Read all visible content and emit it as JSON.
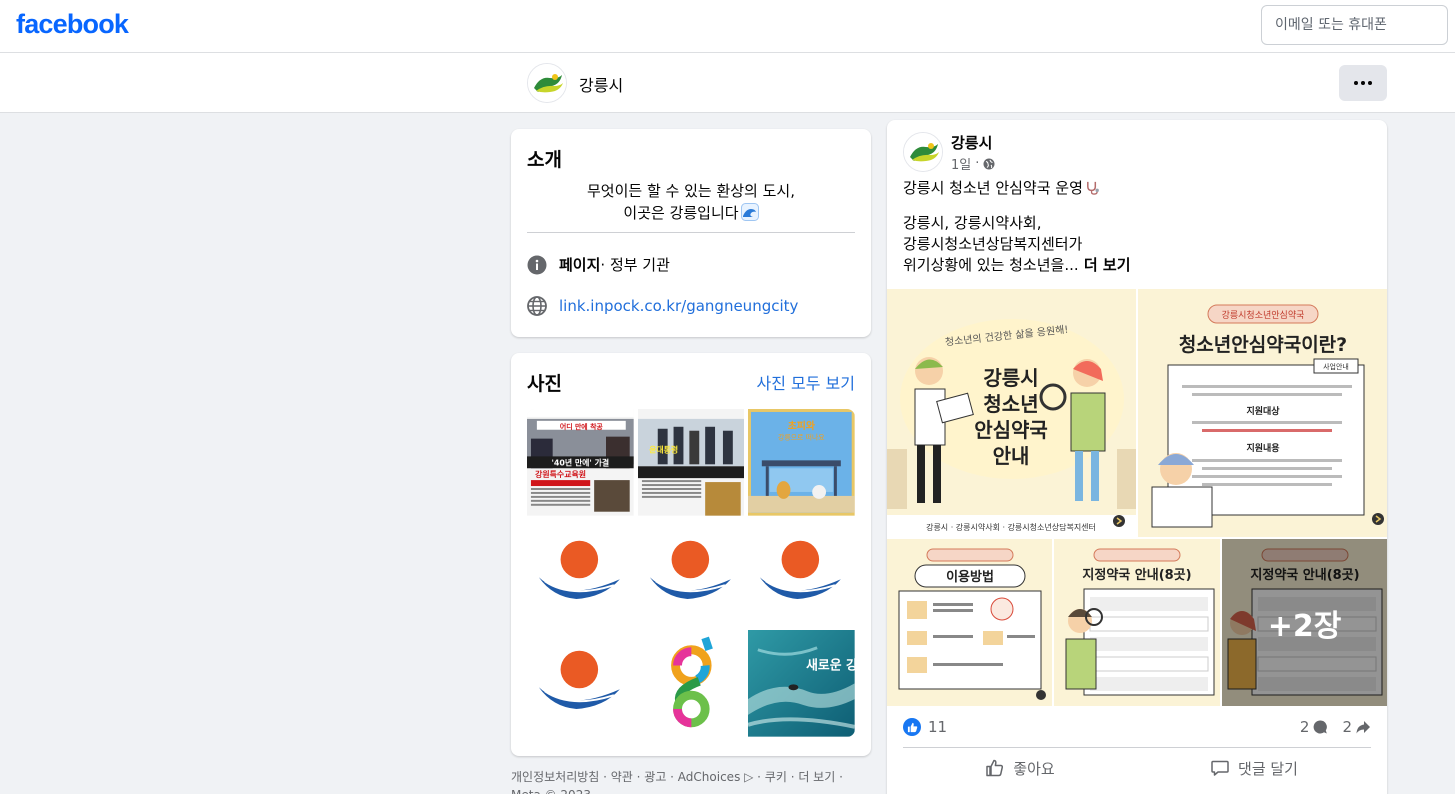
{
  "topbar": {
    "logo": "facebook",
    "login_placeholder": "이메일 또는 휴대폰"
  },
  "page_header": {
    "page_name": "강릉시"
  },
  "intro": {
    "title": "소개",
    "bio_line1": "무엇이든 할 수 있는 환상의 도시,",
    "bio_line2": "이곳은 강릉입니다",
    "category_label": "페이지",
    "category_value": " · 정부 기관",
    "website": "link.inpock.co.kr/gangneungcity"
  },
  "photos": {
    "title": "사진",
    "see_all": "사진 모두 보기",
    "items": [
      {
        "name": "news-clip-1",
        "headline": "강원특수교육원"
      },
      {
        "name": "news-clip-2",
        "headline": "윤대통령"
      },
      {
        "name": "bus-stop",
        "headline": "초피와"
      },
      {
        "name": "logo-sun-1"
      },
      {
        "name": "logo-sun-2"
      },
      {
        "name": "logo-sun-3"
      },
      {
        "name": "logo-sun-4"
      },
      {
        "name": "logo-g"
      },
      {
        "name": "ocean-surfer",
        "headline": "새로운 강"
      }
    ]
  },
  "footer": {
    "line1": "개인정보처리방침 · 약관 · 광고 · AdChoices ▷ · 쿠키 · 더 보기 ·",
    "line2": "Meta © 2023"
  },
  "post": {
    "author": "강릉시",
    "time": "1일",
    "line1": "강릉시 청소년 안심약국 운영",
    "line2": "강릉시, 강릉시약사회,",
    "line3": "강릉시청소년상담복지센터가",
    "line4": "위기상황에 있는 청소년을...",
    "see_more": " 더 보기",
    "image1_title1": "강릉시",
    "image1_title2": "청소년",
    "image1_title3": "안심약국",
    "image1_title4": "안내",
    "image1_tagline": "청소년의 건강한 삶을 응원해!",
    "image2_badge": "강릉시청소년안심약국",
    "image2_title": "청소년안심약국이란?",
    "image3_title": "이용방법",
    "image4_title": "지정약국 안내(8곳)",
    "image5_title": "지정약국 안내(8곳)",
    "more_images": "+2장",
    "like_count": "11",
    "comment_count": "2",
    "share_count": "2",
    "like_label": "좋아요",
    "comment_label": "댓글 달기"
  },
  "colors": {
    "brand": "#0866ff",
    "link": "#216fdb",
    "background": "#f0f2f5"
  }
}
